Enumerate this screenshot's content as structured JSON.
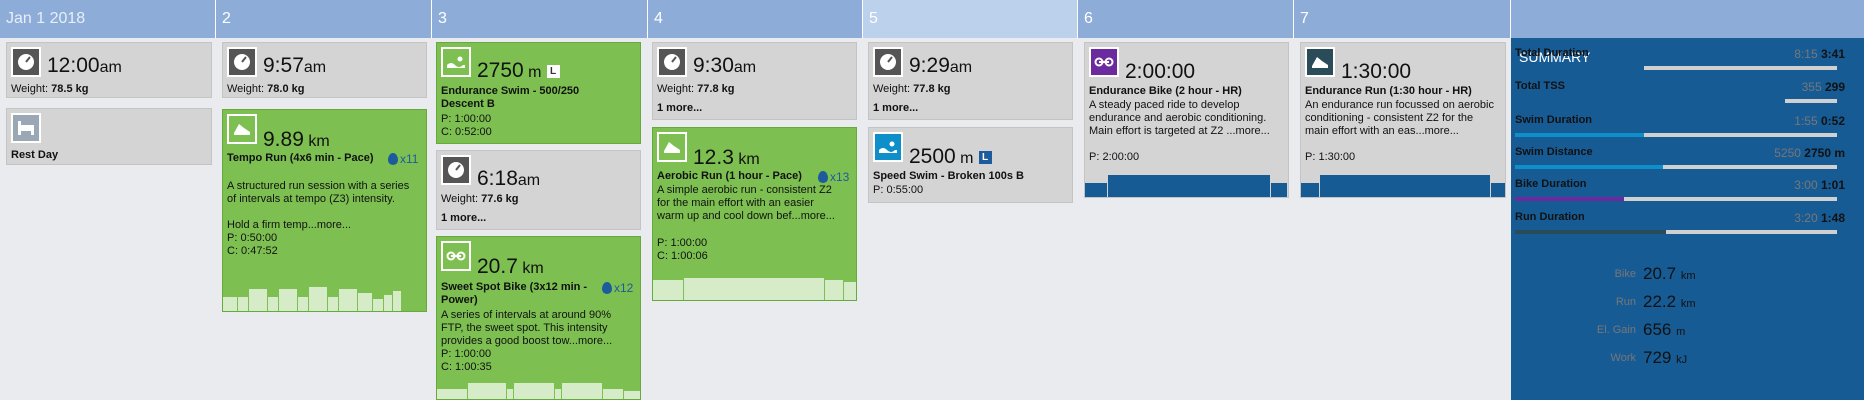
{
  "header": {
    "days": [
      "Jan 1 2018",
      "2",
      "3",
      "4",
      "5",
      "6",
      "7"
    ],
    "summary": "SUMMARY"
  },
  "colors": {
    "workout_green": "#7dc051",
    "header_blue": "#8dadd8",
    "summary_blue": "#175b95",
    "swim": "#0e8fc9",
    "bike": "#6b2a9e",
    "run": "#2a4b58"
  },
  "day1": {
    "metrics": {
      "time": "12:00",
      "ampm": "am",
      "weight_label": "Weight:",
      "weight": "78.5 kg",
      "icon": "scale-icon"
    },
    "rest": {
      "label": "Rest Day",
      "icon": "rest-icon"
    }
  },
  "day2": {
    "metrics": {
      "time": "9:57",
      "ampm": "am",
      "weight_label": "Weight:",
      "weight": "78.0 kg"
    },
    "run": {
      "distance": "9.89",
      "unit": "km",
      "title": "Tempo Run (4x6 min - Pace)",
      "reps": "x11",
      "desc": "A structured run session with a series of intervals at tempo (Z3) intensity.",
      "desc2": "Hold a firm temp...more...",
      "planned": "P: 0:50:00",
      "completed": "C: 0:47:52"
    }
  },
  "day3": {
    "swim": {
      "distance": "2750",
      "unit": "m",
      "badge": "L",
      "title": "Endurance Swim - 500/250 Descent B",
      "planned": "P: 1:00:00",
      "completed": "C: 0:52:00"
    },
    "metrics": {
      "time": "6:18",
      "ampm": "am",
      "weight_label": "Weight:",
      "weight": "77.6 kg",
      "more": "1 more..."
    },
    "bike": {
      "distance": "20.7",
      "unit": "km",
      "title": "Sweet Spot Bike (3x12 min - Power)",
      "reps": "x12",
      "desc": "A series of intervals at around 90% FTP, the sweet spot. This intensity provides a good boost tow...more...",
      "planned": "P: 1:00:00",
      "completed": "C: 1:00:35"
    }
  },
  "day4": {
    "metrics": {
      "time": "9:30",
      "ampm": "am",
      "weight_label": "Weight:",
      "weight": "77.8 kg",
      "more": "1 more..."
    },
    "run": {
      "distance": "12.3",
      "unit": "km",
      "title": "Aerobic Run (1 hour - Pace)",
      "reps": "x13",
      "desc": "A simple aerobic run - consistent Z2 for the main effort with an easier warm up and cool down bef...more...",
      "planned": "P: 1:00:00",
      "completed": "C: 1:00:06"
    }
  },
  "day5": {
    "metrics": {
      "time": "9:29",
      "ampm": "am",
      "weight_label": "Weight:",
      "weight": "77.8 kg",
      "more": "1 more..."
    },
    "swim": {
      "distance": "2500",
      "unit": "m",
      "badge": "L",
      "title": "Speed Swim - Broken 100s B",
      "planned": "P: 0:55:00"
    }
  },
  "day6": {
    "bike": {
      "duration": "2:00:00",
      "title": "Endurance Bike (2 hour - HR)",
      "desc": "A steady paced ride to develop endurance and aerobic conditioning. Main effort is targeted at Z2 ...more...",
      "planned": "P: 2:00:00"
    }
  },
  "day7": {
    "run": {
      "duration": "1:30:00",
      "title": "Endurance Run (1:30 hour - HR)",
      "desc": "An endurance run focussed on aerobic conditioning - consistent Z2 for the main effort with an eas...more...",
      "planned": "P: 1:30:00"
    }
  },
  "summary": {
    "rows": [
      {
        "label": "Total Duration",
        "planned": "8:15",
        "actual": "3:41",
        "progress": 0.4,
        "color": "#175b95"
      },
      {
        "label": "Total TSS",
        "planned": "355",
        "actual": "299",
        "progress": 0.84,
        "color": "#175b95"
      },
      {
        "label": "Swim Duration",
        "planned": "1:55",
        "actual": "0:52",
        "progress": 0.4,
        "color": "#0e8fc9"
      },
      {
        "label": "Swim Distance",
        "planned": "5250",
        "actual": "2750 m",
        "progress": 0.46,
        "color": "#0e8fc9"
      },
      {
        "label": "Bike Duration",
        "planned": "3:00",
        "actual": "1:01",
        "progress": 0.34,
        "color": "#6b2a9e"
      },
      {
        "label": "Run Duration",
        "planned": "3:20",
        "actual": "1:48",
        "progress": 0.47,
        "color": "#2a4b58"
      }
    ],
    "totals": [
      {
        "label": "Bike",
        "value": "20.7",
        "unit": "km"
      },
      {
        "label": "Run",
        "value": "22.2",
        "unit": "km"
      },
      {
        "label": "El. Gain",
        "value": "656",
        "unit": "m"
      },
      {
        "label": "Work",
        "value": "729",
        "unit": "kJ"
      }
    ]
  }
}
